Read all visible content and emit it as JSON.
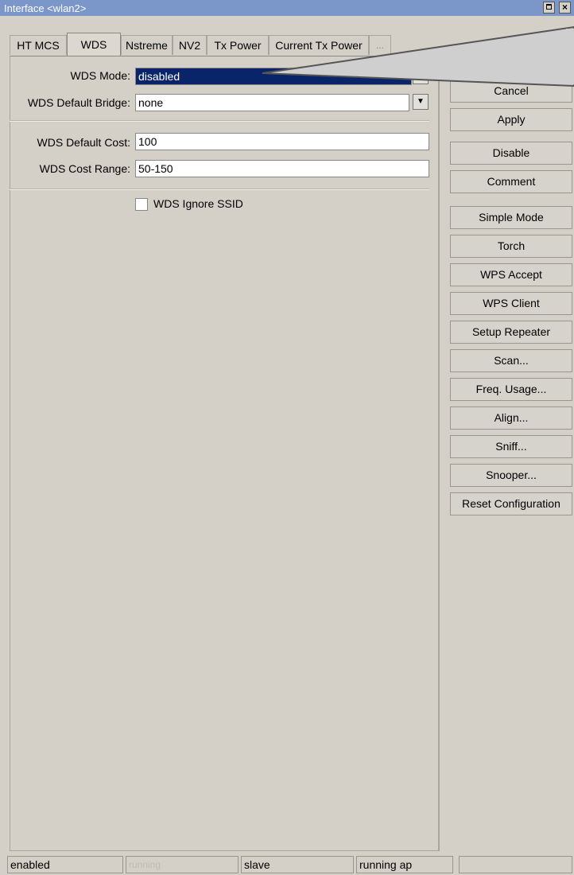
{
  "window": {
    "title": "Interface <wlan2>",
    "buttons": [
      "maximize-icon",
      "close-icon"
    ]
  },
  "tabs": [
    {
      "label": "HT MCS",
      "active": false
    },
    {
      "label": "WDS",
      "active": true
    },
    {
      "label": "Nstreme",
      "active": false
    },
    {
      "label": "NV2",
      "active": false
    },
    {
      "label": "Tx Power",
      "active": false
    },
    {
      "label": "Current Tx Power",
      "active": false
    },
    {
      "label": "...",
      "active": false
    }
  ],
  "form": {
    "wds_mode": {
      "label": "WDS Mode:",
      "value": "disabled"
    },
    "wds_default_bridge": {
      "label": "WDS Default Bridge:",
      "value": "none"
    },
    "wds_default_cost": {
      "label": "WDS Default Cost:",
      "value": "100"
    },
    "wds_cost_range": {
      "label": "WDS Cost Range:",
      "value": "50-150"
    },
    "wds_ignore_ssid": {
      "label": "WDS Ignore SSID",
      "checked": false
    }
  },
  "buttons": [
    "Cancel",
    "Apply",
    "Disable",
    "Comment",
    "Simple Mode",
    "Torch",
    "WPS Accept",
    "WPS Client",
    "Setup Repeater",
    "Scan...",
    "Freq. Usage...",
    "Align...",
    "Sniff...",
    "Snooper...",
    "Reset Configuration"
  ],
  "status": [
    "enabled",
    "running",
    "slave",
    "running ap",
    ""
  ]
}
